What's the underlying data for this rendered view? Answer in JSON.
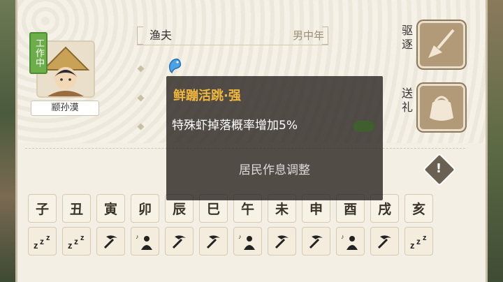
{
  "resident": {
    "status": "工作中",
    "name": "颛孙漠",
    "job": "渔夫",
    "meta": "男中年"
  },
  "actions": [
    {
      "label": "驱逐",
      "icon": "broom-icon"
    },
    {
      "label": "送礼",
      "icon": "gift-bag-icon"
    }
  ],
  "tooltip": {
    "title": "鲜蹦活跳·强",
    "description": "特殊虾掉落概率增加5%"
  },
  "schedule": {
    "title": "居民作息调整",
    "hours": [
      "子",
      "丑",
      "寅",
      "卯",
      "辰",
      "巳",
      "午",
      "未",
      "申",
      "酉",
      "戌",
      "亥"
    ],
    "activities": [
      "sleep",
      "sleep",
      "work",
      "idle",
      "work",
      "work",
      "idle",
      "work",
      "work",
      "idle",
      "work",
      "sleep"
    ]
  },
  "colors": {
    "tooltip_title": "#f0b73c",
    "status_green": "#6cae4a",
    "panel_bg": "#f3efe4"
  }
}
